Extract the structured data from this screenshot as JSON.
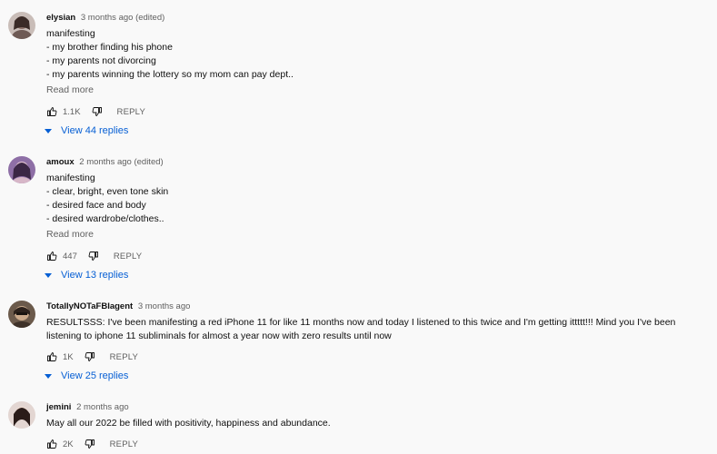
{
  "comments": [
    {
      "author": "elysian",
      "meta": "3 months ago (edited)",
      "lines": [
        "manifesting",
        "- my brother finding his phone",
        "- my parents not divorcing",
        "- my parents winning the lottery so my mom can pay dept.."
      ],
      "read_more": "Read more",
      "likes": "1.1K",
      "reply": "REPLY",
      "view_replies": "View 44 replies",
      "avatar_color": "#b9a6a2"
    },
    {
      "author": "amoux",
      "meta": "2 months ago (edited)",
      "lines": [
        "manifesting",
        "- clear, bright, even tone skin",
        "- desired face and body",
        "- desired wardrobe/clothes.."
      ],
      "read_more": "Read more",
      "likes": "447",
      "reply": "REPLY",
      "view_replies": "View 13 replies",
      "avatar_color": "#9c7fb0"
    },
    {
      "author": "TotallyNOTaFBIagent",
      "meta": "3 months ago",
      "text": "RESULTSSS: I've been manifesting a red iPhone 11 for like 11 months now and today I listened to this twice and I'm getting ittttt!!! Mind you I've been listening to iphone 11 subliminals for almost a year now with zero results until now",
      "likes": "1K",
      "reply": "REPLY",
      "view_replies": "View 25 replies",
      "avatar_color": "#5a4a3e"
    },
    {
      "author": "jemini",
      "meta": "2 months ago",
      "text": "May all our 2022 be filled with positivity, happiness and abundance.",
      "likes": "2K",
      "reply": "REPLY",
      "avatar_color": "#d8c9c4"
    }
  ]
}
